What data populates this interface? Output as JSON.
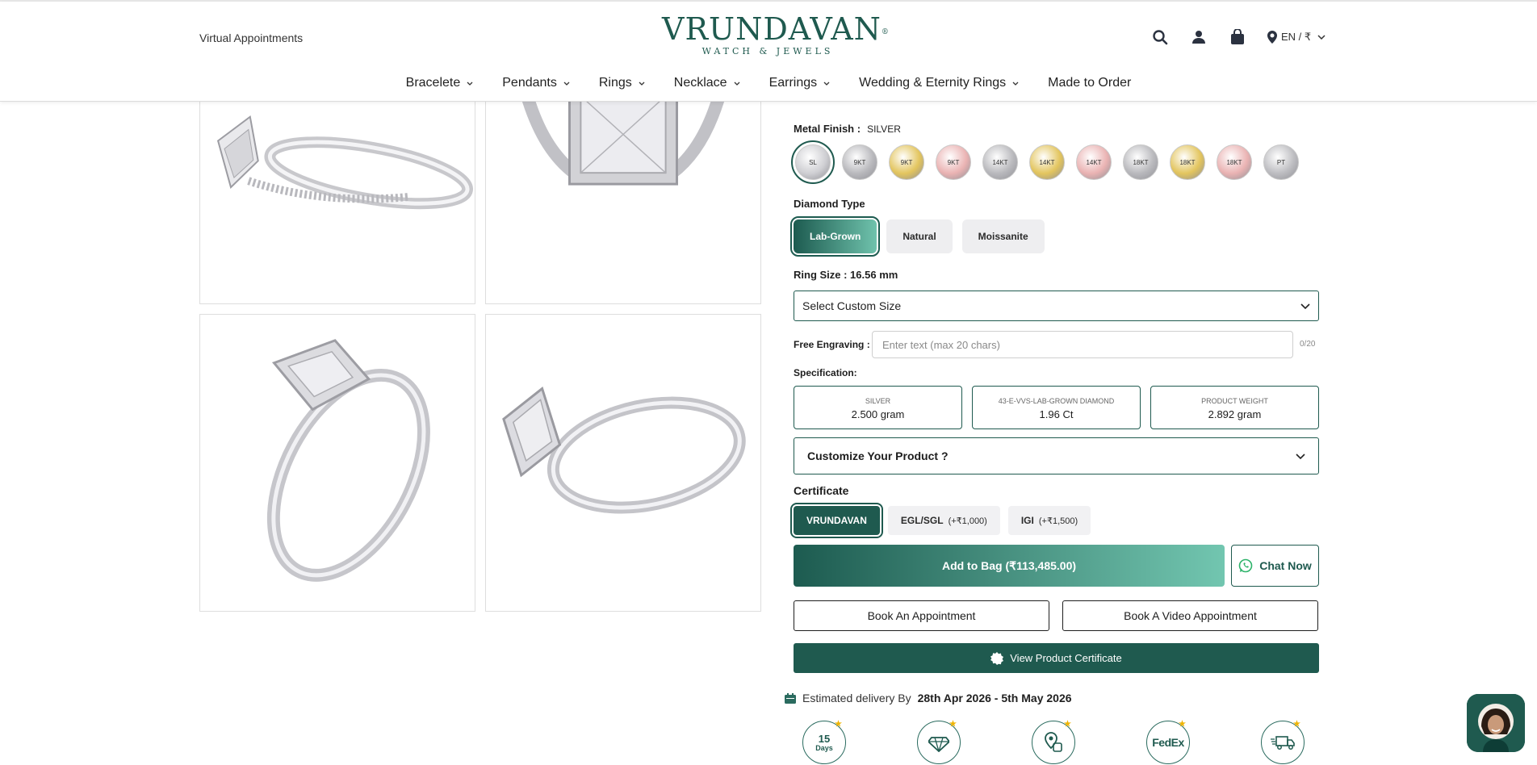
{
  "header": {
    "virtual_appointments": "Virtual Appointments",
    "logo_main": "VRUNDAVAN",
    "logo_reg": "®",
    "logo_sub": "WATCH & JEWELS",
    "lang": "EN / ₹"
  },
  "nav": {
    "items": [
      {
        "label": "Bracelete",
        "dropdown": true
      },
      {
        "label": "Pendants",
        "dropdown": true
      },
      {
        "label": "Rings",
        "dropdown": true
      },
      {
        "label": "Necklace",
        "dropdown": true
      },
      {
        "label": "Earrings",
        "dropdown": true
      },
      {
        "label": "Wedding & Eternity Rings",
        "dropdown": true
      },
      {
        "label": "Made to Order",
        "dropdown": false
      }
    ]
  },
  "product": {
    "metal_finish_label": "Metal Finish :",
    "metal_finish_value": "SILVER",
    "swatches": [
      {
        "code": "SL",
        "color": "#cfcfd3",
        "selected": true
      },
      {
        "code": "9KT",
        "color": "#b9b9bd"
      },
      {
        "code": "9KT",
        "color": "#e3c55e"
      },
      {
        "code": "9KT",
        "color": "#eab3b3"
      },
      {
        "code": "14KT",
        "color": "#b9b9bd"
      },
      {
        "code": "14KT",
        "color": "#e3c55e"
      },
      {
        "code": "14KT",
        "color": "#eab3b3"
      },
      {
        "code": "18KT",
        "color": "#b9b9bd"
      },
      {
        "code": "18KT",
        "color": "#e3c55e"
      },
      {
        "code": "18KT",
        "color": "#eab3b3"
      },
      {
        "code": "PT",
        "color": "#bdbdc1"
      }
    ],
    "diamond_type_label": "Diamond Type",
    "diamond_types": [
      {
        "label": "Lab-Grown",
        "active": true
      },
      {
        "label": "Natural",
        "active": false
      },
      {
        "label": "Moissanite",
        "active": false
      }
    ],
    "ring_size_label": "Ring Size : 16.56 mm",
    "select_size": "Select Custom Size",
    "engraving_label": "Free Engraving :",
    "engraving_placeholder": "Enter text (max 20 chars)",
    "engraving_count": "0/20",
    "specification_label": "Specification:",
    "specs": [
      {
        "key": "SILVER",
        "value": "2.500 gram"
      },
      {
        "key": "43-E-VVS-LAB-GROWN DIAMOND",
        "value": "1.96 Ct"
      },
      {
        "key": "PRODUCT WEIGHT",
        "value": "2.892 gram"
      }
    ],
    "customize": "Customize Your Product ?",
    "certificate_label": "Certificate",
    "certificates": [
      {
        "label": "VRUNDAVAN",
        "extra": "",
        "active": true
      },
      {
        "label": "EGL/SGL",
        "extra": "(+₹1,000)",
        "active": false
      },
      {
        "label": "IGI",
        "extra": "(+₹1,500)",
        "active": false
      }
    ],
    "add_to_bag": "Add to Bag (₹113,485.00)",
    "chat_now": "Chat Now",
    "book_appointment": "Book An Appointment",
    "book_video": "Book A Video Appointment",
    "view_certificate": "View Product Certificate",
    "delivery_label": "Estimated delivery By",
    "delivery_dates": "28th Apr 2026 - 5th May 2026",
    "badges": [
      {
        "icon": "15-days-return-icon",
        "line1": "15",
        "line2": "Days"
      },
      {
        "icon": "certified-diamond-icon"
      },
      {
        "icon": "store-locator-icon"
      },
      {
        "icon": "fedex-shipping-icon",
        "line1": "FedEx"
      },
      {
        "icon": "free-delivery-truck-icon"
      }
    ]
  },
  "colors": {
    "brand": "#1f5a4f",
    "gradient_end": "#72c6b0",
    "badge_star": "#f0b400"
  }
}
